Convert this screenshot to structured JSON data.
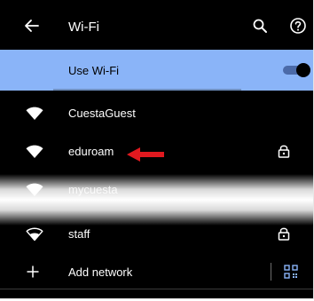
{
  "appbar": {
    "title": "Wi-Fi",
    "back_icon": "arrow-left-icon",
    "search_icon": "search-icon",
    "help_icon": "help-circle-icon"
  },
  "toggle": {
    "label": "Use Wi-Fi",
    "on": true,
    "accent": "#8ab4f8"
  },
  "networks": [
    {
      "name": "CuestaGuest",
      "locked": false
    },
    {
      "name": "eduroam",
      "locked": true
    },
    {
      "name": "mycuesta",
      "locked": false
    },
    {
      "name": "staff",
      "locked": true
    }
  ],
  "add_network": {
    "label": "Add network",
    "plus_icon": "plus-icon",
    "qr_icon": "qr-code-scanner-icon"
  },
  "annotation": {
    "arrow_icon": "red-arrow-icon",
    "color": "#e0191f"
  }
}
